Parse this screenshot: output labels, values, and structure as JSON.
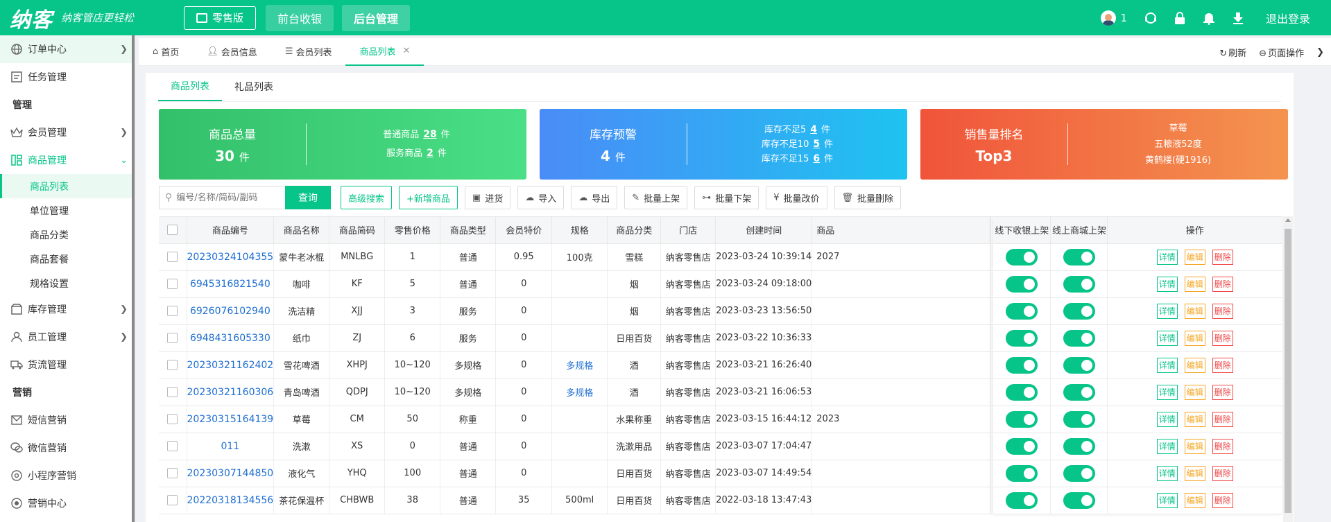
{
  "topbar": {
    "logo": "纳客",
    "slogan": "纳客管店更轻松",
    "edition": "零售版",
    "tabs": [
      "前台收银",
      "后台管理"
    ],
    "user_count": "1",
    "logout": "退出登录"
  },
  "sidebar": {
    "items": [
      {
        "label": "订单中心",
        "icon": "globe-icon",
        "type": "item"
      },
      {
        "label": "任务管理",
        "icon": "task-icon",
        "type": "item"
      },
      {
        "label": "管理",
        "type": "group"
      },
      {
        "label": "会员管理",
        "icon": "crown-icon",
        "type": "item"
      },
      {
        "label": "商品管理",
        "icon": "grid-icon",
        "type": "item"
      },
      {
        "label": "商品列表",
        "type": "sub"
      },
      {
        "label": "单位管理",
        "type": "sub"
      },
      {
        "label": "商品分类",
        "type": "sub"
      },
      {
        "label": "商品套餐",
        "type": "sub"
      },
      {
        "label": "规格设置",
        "type": "sub"
      },
      {
        "label": "库存管理",
        "icon": "box-icon",
        "type": "item"
      },
      {
        "label": "员工管理",
        "icon": "user-icon",
        "type": "item"
      },
      {
        "label": "货流管理",
        "icon": "truck-icon",
        "type": "item"
      },
      {
        "label": "营销",
        "type": "group"
      },
      {
        "label": "短信营销",
        "icon": "mail-icon",
        "type": "item"
      },
      {
        "label": "微信营销",
        "icon": "wechat-icon",
        "type": "item"
      },
      {
        "label": "小程序营销",
        "icon": "miniapp-icon",
        "type": "item"
      },
      {
        "label": "营销中心",
        "icon": "target-icon",
        "type": "item"
      }
    ]
  },
  "crumbs": [
    "首页",
    "会员信息",
    "会员列表",
    "商品列表"
  ],
  "crumb_right": {
    "refresh": "刷新",
    "page_ops": "页面操作"
  },
  "subtabs": [
    "商品列表",
    "礼品列表"
  ],
  "cards": {
    "total": {
      "title": "商品总量",
      "value": "30",
      "unit": "件",
      "lines": [
        {
          "pre": "普通商品",
          "num": "28",
          "unit": "件"
        },
        {
          "pre": "服务商品",
          "num": "2",
          "unit": "件"
        }
      ]
    },
    "stock": {
      "title": "库存预警",
      "value": "4",
      "unit": "件",
      "lines": [
        {
          "pre": "库存不足5",
          "num": "4",
          "unit": "件"
        },
        {
          "pre": "库存不足10",
          "num": "5",
          "unit": "件"
        },
        {
          "pre": "库存不足15",
          "num": "6",
          "unit": "件"
        }
      ]
    },
    "sales": {
      "title": "销售量排名",
      "value": "Top3",
      "lines": [
        "草莓",
        "五粮液52度",
        "黄鹤楼(硬1916)"
      ]
    }
  },
  "toolbar": {
    "search_placeholder": "编号/名称/简码/副码",
    "query": "查询",
    "advanced": "高级搜索",
    "add": "+新增商品",
    "stock_in": "进货",
    "import": "导入",
    "export": "导出",
    "batch_on": "批量上架",
    "batch_off": "批量下架",
    "batch_price": "批量改价",
    "batch_delete": "批量删除"
  },
  "table": {
    "headers": [
      "商品编号",
      "商品名称",
      "商品简码",
      "零售价格",
      "商品类型",
      "会员特价",
      "规格",
      "商品分类",
      "门店",
      "创建时间",
      "商品"
    ],
    "fixed_headers": [
      "线下收银上架",
      "线上商城上架",
      "操作"
    ],
    "actions": {
      "detail": "详情",
      "edit": "编辑",
      "delete": "删除"
    },
    "rows": [
      {
        "code": "20230324104355",
        "name": "蒙牛老冰棍",
        "short": "MNLBG",
        "price": "1",
        "type": "普通",
        "member": "0.95",
        "spec": "100克",
        "spec_link": false,
        "category": "雪糕",
        "store": "纳客零售店",
        "created": "2023-03-24 10:39:14",
        "extra": "2027"
      },
      {
        "code": "6945316821540",
        "name": "咖啡",
        "short": "KF",
        "price": "5",
        "type": "普通",
        "member": "0",
        "spec": "",
        "spec_link": false,
        "category": "烟",
        "store": "纳客零售店",
        "created": "2023-03-24 09:18:00",
        "extra": ""
      },
      {
        "code": "6926076102940",
        "name": "洗洁精",
        "short": "XJJ",
        "price": "3",
        "type": "服务",
        "member": "0",
        "spec": "",
        "spec_link": false,
        "category": "烟",
        "store": "纳客零售店",
        "created": "2023-03-23 13:56:50",
        "extra": ""
      },
      {
        "code": "6948431605330",
        "name": "纸巾",
        "short": "ZJ",
        "price": "6",
        "type": "服务",
        "member": "0",
        "spec": "",
        "spec_link": false,
        "category": "日用百货",
        "store": "纳客零售店",
        "created": "2023-03-22 10:36:33",
        "extra": ""
      },
      {
        "code": "20230321162402",
        "name": "雪花啤酒",
        "short": "XHPJ",
        "price": "10~120",
        "type": "多规格",
        "member": "0",
        "spec": "多规格",
        "spec_link": true,
        "category": "酒",
        "store": "纳客零售店",
        "created": "2023-03-21 16:26:40",
        "extra": ""
      },
      {
        "code": "20230321160306",
        "name": "青岛啤酒",
        "short": "QDPJ",
        "price": "10~120",
        "type": "多规格",
        "member": "0",
        "spec": "多规格",
        "spec_link": true,
        "category": "酒",
        "store": "纳客零售店",
        "created": "2023-03-21 16:06:53",
        "extra": ""
      },
      {
        "code": "20230315164139",
        "name": "草莓",
        "short": "CM",
        "price": "50",
        "type": "称重",
        "member": "0",
        "spec": "",
        "spec_link": false,
        "category": "水果称重",
        "store": "纳客零售店",
        "created": "2023-03-15 16:44:12",
        "extra": "2023"
      },
      {
        "code": "011",
        "name": "洗漱",
        "short": "XS",
        "price": "0",
        "type": "普通",
        "member": "0",
        "spec": "",
        "spec_link": false,
        "category": "洗漱用品",
        "store": "纳客零售店",
        "created": "2023-03-07 17:04:47",
        "extra": ""
      },
      {
        "code": "20230307144850",
        "name": "液化气",
        "short": "YHQ",
        "price": "100",
        "type": "普通",
        "member": "0",
        "spec": "",
        "spec_link": false,
        "category": "日用百货",
        "store": "纳客零售店",
        "created": "2023-03-07 14:49:54",
        "extra": ""
      },
      {
        "code": "20220318134556",
        "name": "茶花保温杯",
        "short": "CHBWB",
        "price": "38",
        "type": "普通",
        "member": "35",
        "spec": "500ml",
        "spec_link": false,
        "category": "日用百货",
        "store": "纳客零售店",
        "created": "2022-03-18 13:47:43",
        "extra": ""
      }
    ]
  },
  "colors": {
    "brand": "#07c489",
    "link": "#1f6fd1",
    "edit": "#f5a623",
    "delete": "#f04848"
  }
}
